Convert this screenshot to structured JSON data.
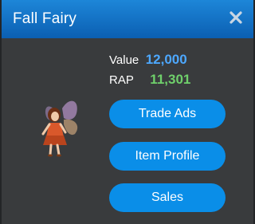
{
  "header": {
    "title": "Fall Fairy",
    "close_icon": "close-icon"
  },
  "stats": {
    "value_label": "Value",
    "value_amount": "12,000",
    "value_color": "#4da8ff",
    "rap_label": "RAP",
    "rap_amount": "11,301",
    "rap_color": "#6fd06b"
  },
  "buttons": {
    "trade_ads": "Trade Ads",
    "item_profile": "Item Profile",
    "sales": "Sales"
  },
  "item_image": "fall-fairy-item-image"
}
